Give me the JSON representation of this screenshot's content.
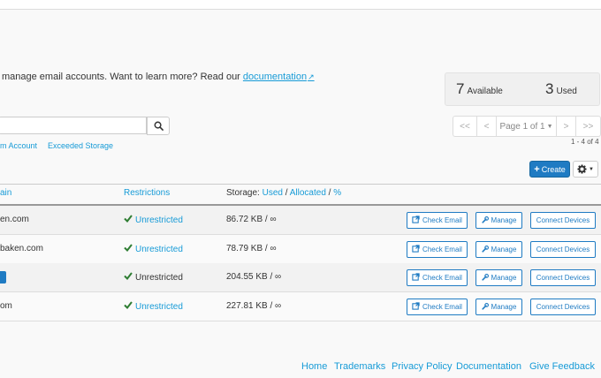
{
  "intro": {
    "text": "manage email accounts. Want to learn more? Read our",
    "link": "documentation"
  },
  "stats": {
    "available_count": "7",
    "available_label": "Available",
    "used_count": "3",
    "used_label": "Used"
  },
  "search": {
    "value": "",
    "placeholder": ""
  },
  "filters": [
    "m Account",
    "Exceeded Storage"
  ],
  "pagination": {
    "first": "<<",
    "prev": "<",
    "page_label": "Page 1 of 1",
    "next": ">",
    "last": ">>",
    "range": "1 - 4 of 4"
  },
  "toolbar": {
    "create_label": "Create"
  },
  "table": {
    "col_domain": "ain",
    "col_restrictions": "Restrictions",
    "col_storage_prefix": "Storage:",
    "col_storage_used": "Used",
    "col_storage_sep1": "/",
    "col_storage_allocated": "Allocated",
    "col_storage_sep2": "/",
    "col_storage_percent": "%",
    "rows": [
      {
        "domain": "en.com",
        "restriction": "Unrestricted",
        "storage": "86.72 KB / ∞"
      },
      {
        "domain": "baken.com",
        "restriction": "Unrestricted",
        "storage": "78.79 KB / ∞"
      },
      {
        "domain": "",
        "restriction": "Unrestricted",
        "storage": "204.55 KB / ∞"
      },
      {
        "domain": "om",
        "restriction": "Unrestricted",
        "storage": "227.81 KB / ∞"
      }
    ],
    "actions": {
      "check_email": "Check Email",
      "manage": "Manage",
      "connect_devices": "Connect Devices"
    }
  },
  "footer": {
    "home": "Home",
    "trademarks": "Trademarks",
    "privacy": "Privacy Policy",
    "documentation": "Documentation",
    "feedback": "Give Feedback"
  },
  "colors": {
    "accent": "#179bd7",
    "primary_button": "#1f7bc3",
    "check": "#2e7d32"
  }
}
